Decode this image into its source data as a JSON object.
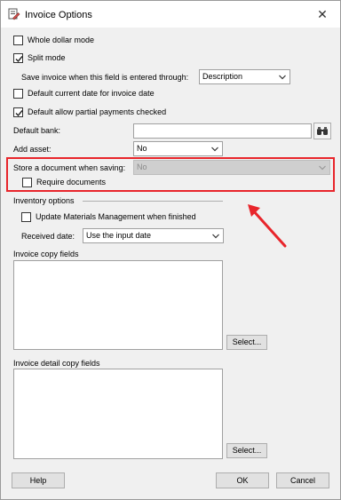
{
  "window": {
    "title": "Invoice Options",
    "close_glyph": "✕"
  },
  "options": {
    "whole_dollar_mode": {
      "label": "Whole dollar mode",
      "checked": false
    },
    "split_mode": {
      "label": "Split mode",
      "checked": true
    },
    "save_invoice": {
      "label": "Save invoice when this field is entered through:",
      "value": "Description"
    },
    "default_current_date": {
      "label": "Default current date for invoice date",
      "checked": false
    },
    "default_partial_payments": {
      "label": "Default allow partial payments checked",
      "checked": true
    },
    "default_bank": {
      "label": "Default bank:",
      "value": "",
      "search_icon": "binoculars-icon"
    },
    "add_asset": {
      "label": "Add asset:",
      "value": "No"
    },
    "store_document": {
      "label": "Store a document when saving:",
      "value": "No",
      "disabled": true
    },
    "require_documents": {
      "label": "Require documents",
      "checked": false
    }
  },
  "inventory": {
    "group_label": "Inventory options",
    "update_materials": {
      "label": "Update Materials Management when finished",
      "checked": false
    },
    "received_date": {
      "label": "Received date:",
      "value": "Use the input date"
    }
  },
  "invoice_copy_fields": {
    "label": "Invoice copy fields",
    "select_button": "Select..."
  },
  "invoice_detail_copy_fields": {
    "label": "Invoice detail copy fields",
    "select_button": "Select..."
  },
  "footer": {
    "help": "Help",
    "ok": "OK",
    "cancel": "Cancel"
  },
  "annotation": {
    "highlight_color": "#e8252b",
    "arrow_color": "#e8252b"
  }
}
